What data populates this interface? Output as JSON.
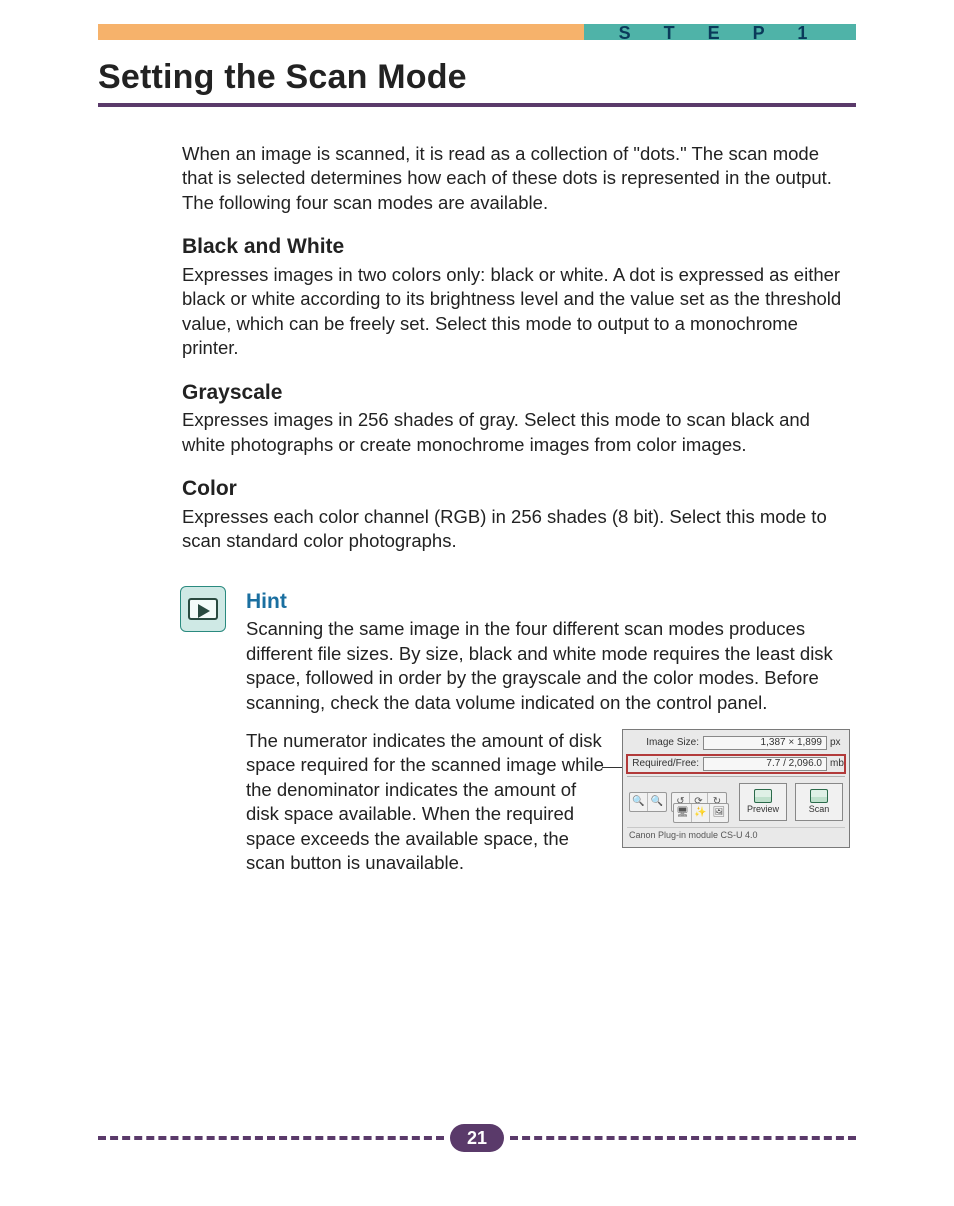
{
  "header": {
    "step_label": "S T E P   1",
    "title": "Setting the Scan Mode"
  },
  "intro": "When an image is scanned, it is read as a collection of \"dots.\" The scan mode that is selected determines how each of these dots is represented in the output. The following four scan modes are available.",
  "sections": {
    "bw": {
      "heading": "Black and White",
      "text": "Expresses images in two colors only: black or white. A dot is expressed as either black or white according to its brightness level and the value set as the threshold value, which can be freely set. Select this mode to output to a monochrome printer."
    },
    "gray": {
      "heading": "Grayscale",
      "text": "Expresses images in 256 shades of gray. Select this mode to scan black and white photographs or create monochrome images from color images."
    },
    "color": {
      "heading": "Color",
      "text": "Expresses each color channel (RGB) in 256 shades (8 bit). Select this mode to scan standard color photographs."
    }
  },
  "hint": {
    "title": "Hint",
    "para1": "Scanning the same image in the four different scan modes produces different file sizes. By size, black and white mode requires the least disk space, followed in order by the grayscale and the color modes. Before scanning, check the data volume indicated on the control panel.",
    "para2": "The numerator indicates the amount of disk space required for the scanned image while the denominator indicates the amount of disk space available. When the required space exceeds the available space, the scan button is unavailable."
  },
  "panel": {
    "image_size_label": "Image Size:",
    "image_size_value": "1,387 × 1,899",
    "image_size_unit": "px",
    "required_free_label": "Required/Free:",
    "required_free_value": "7.7 / 2,096.0",
    "required_free_unit": "mb",
    "preview_label": "Preview",
    "scan_label": "Scan",
    "footer": "Canon Plug-in module CS-U 4.0"
  },
  "page_number": "21"
}
